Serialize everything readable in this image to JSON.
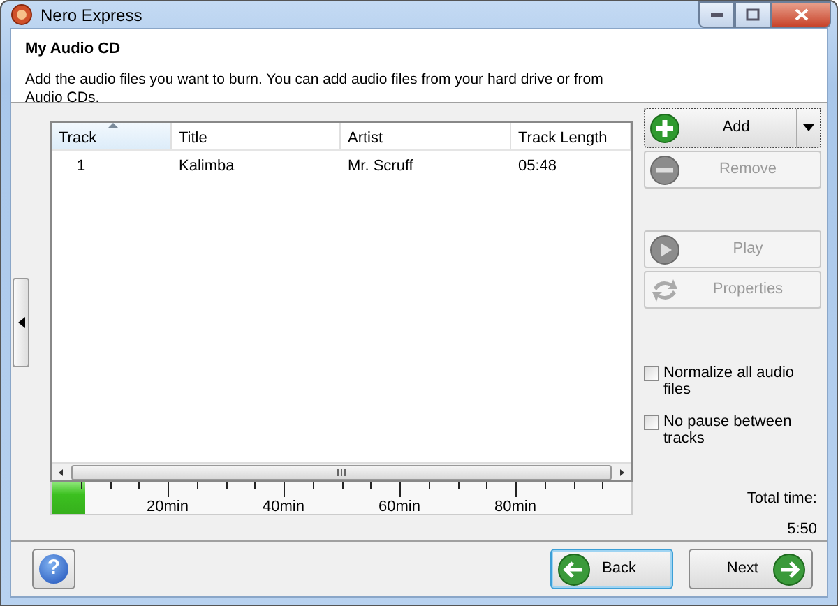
{
  "window": {
    "title": "Nero Express"
  },
  "header": {
    "title": "My Audio CD",
    "description": "Add the audio files you want to burn. You can add audio files from your hard drive or from Audio CDs."
  },
  "table": {
    "columns": [
      {
        "label": "Track",
        "sorted": true
      },
      {
        "label": "Title",
        "sorted": false
      },
      {
        "label": "Artist",
        "sorted": false
      },
      {
        "label": "Track Length",
        "sorted": false
      }
    ],
    "rows": [
      [
        "1",
        "Kalimba",
        "Mr. Scruff",
        "05:48"
      ]
    ]
  },
  "timeline": {
    "level": 0.058,
    "labels": [
      "20min",
      "40min",
      "60min",
      "80min"
    ]
  },
  "buttons": [
    {
      "kind": "add",
      "label": "Add",
      "disabled": false
    },
    {
      "kind": "remove",
      "label": "Remove",
      "disabled": true
    },
    {
      "kind": "play",
      "label": "Play",
      "disabled": true
    },
    {
      "kind": "properties",
      "label": "Properties",
      "disabled": true
    }
  ],
  "options": [
    {
      "label": "Normalize all audio files",
      "checked": false
    },
    {
      "label": "No pause between tracks",
      "checked": false
    }
  ],
  "total": {
    "label": "Total time:",
    "value": "5:50"
  },
  "footer": {
    "help": "?",
    "back": "Back",
    "next": "Next"
  }
}
